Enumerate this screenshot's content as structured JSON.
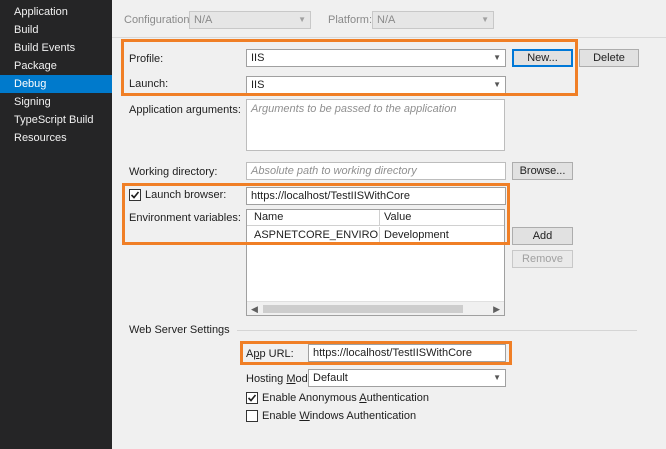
{
  "sidebar": {
    "items": [
      {
        "label": "Application"
      },
      {
        "label": "Build"
      },
      {
        "label": "Build Events"
      },
      {
        "label": "Package"
      },
      {
        "label": "Debug"
      },
      {
        "label": "Signing"
      },
      {
        "label": "TypeScript Build"
      },
      {
        "label": "Resources"
      }
    ],
    "active": "Debug"
  },
  "topbar": {
    "configuration_label": "Configuration:",
    "configuration_value": "N/A",
    "platform_label": "Platform:",
    "platform_value": "N/A"
  },
  "profile": {
    "label": "Profile:",
    "value": "IIS",
    "new_button": "New...",
    "delete_button": "Delete"
  },
  "launch": {
    "label": "Launch:",
    "value": "IIS"
  },
  "app_args": {
    "label": "Application arguments:",
    "placeholder": "Arguments to be passed to the application"
  },
  "working_dir": {
    "label": "Working directory:",
    "placeholder": "Absolute path to working directory",
    "browse_button": "Browse..."
  },
  "launch_browser": {
    "label": "Launch browser:",
    "checked": true,
    "value": "https://localhost/TestIISWithCore"
  },
  "env_vars": {
    "label": "Environment variables:",
    "columns": [
      "Name",
      "Value"
    ],
    "rows": [
      {
        "name": "ASPNETCORE_ENVIRONMENT",
        "value": "Development"
      }
    ],
    "add_button": "Add",
    "remove_button": "Remove"
  },
  "web_server": {
    "section_title": "Web Server Settings",
    "app_url_label_pre": "A",
    "app_url_label_u": "p",
    "app_url_label_post": "p URL:",
    "app_url_value": "https://localhost/TestIISWithCore",
    "hosting_model_label_pre": "Hosting ",
    "hosting_model_label_u": "M",
    "hosting_model_label_post": "odel:",
    "hosting_model_value": "Default",
    "anon_auth_label_pre": "Enable Anonymous ",
    "anon_auth_label_u": "A",
    "anon_auth_label_post": "uthentication",
    "anon_auth_checked": true,
    "win_auth_label_pre": "Enable ",
    "win_auth_label_u": "W",
    "win_auth_label_post": "indows Authentication",
    "win_auth_checked": false
  },
  "colors": {
    "accent": "#007acc",
    "highlight": "#f07f26",
    "sidebar_bg": "#252526"
  }
}
